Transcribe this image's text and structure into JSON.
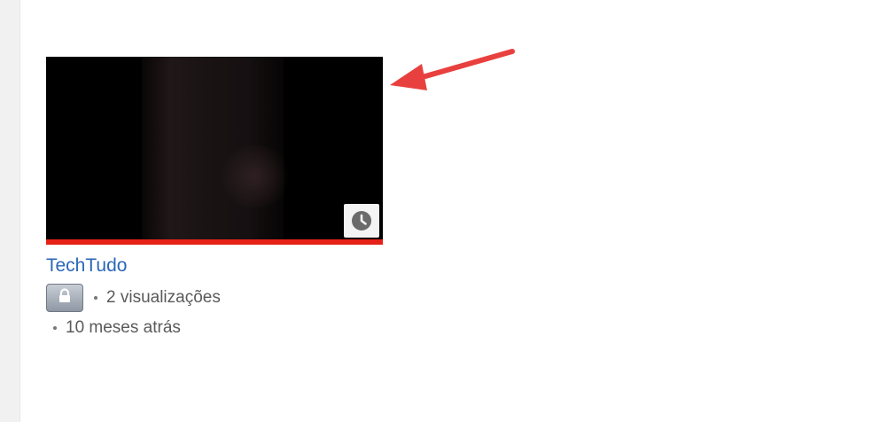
{
  "video": {
    "progress_percent": 100,
    "progress_color": "#e62117",
    "overlay_icon": "clock-icon",
    "channel": "TechTudo",
    "privacy_icon": "lock-icon",
    "views": "2 visualizações",
    "age": "10 meses atrás"
  },
  "annotation": {
    "icon": "red-arrow-icon",
    "color": "#e8403e"
  }
}
